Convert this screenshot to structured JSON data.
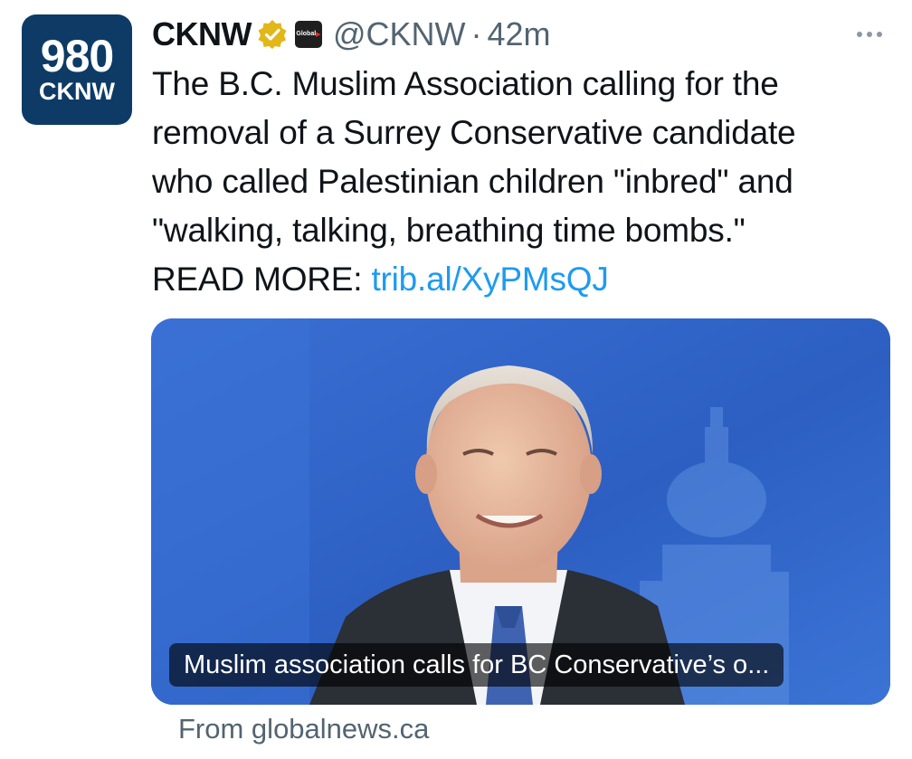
{
  "author": {
    "avatar_line1": "980",
    "avatar_line2": "CKNW",
    "display_name": "CKNW",
    "affiliate_badge_text": "Global",
    "handle": "@CKNW",
    "separator": "·",
    "time": "42m"
  },
  "tweet": {
    "lines": [
      "The B.C. Muslim Association calling for the",
      "removal of a Surrey Conservative candidate",
      "who called Palestinian children \"inbred\" and",
      "\"walking, talking, breathing time bombs.\""
    ],
    "read_more_label": "READ MORE:",
    "link_text": "trib.al/XyPMsQJ"
  },
  "card": {
    "caption": "Muslim association calls for BC Conservative’s o...",
    "source": "From globalnews.ca"
  },
  "icons": {
    "verified": "gold-verified-badge-icon",
    "affiliate": "global-news-affiliate-icon",
    "more": "more-options-icon"
  },
  "colors": {
    "avatar_bg": "#0d3b66",
    "link": "#1d9bf0",
    "secondary_text": "#536471",
    "verified_gold": "#e2b719",
    "card_bg": "#2f63c7"
  }
}
